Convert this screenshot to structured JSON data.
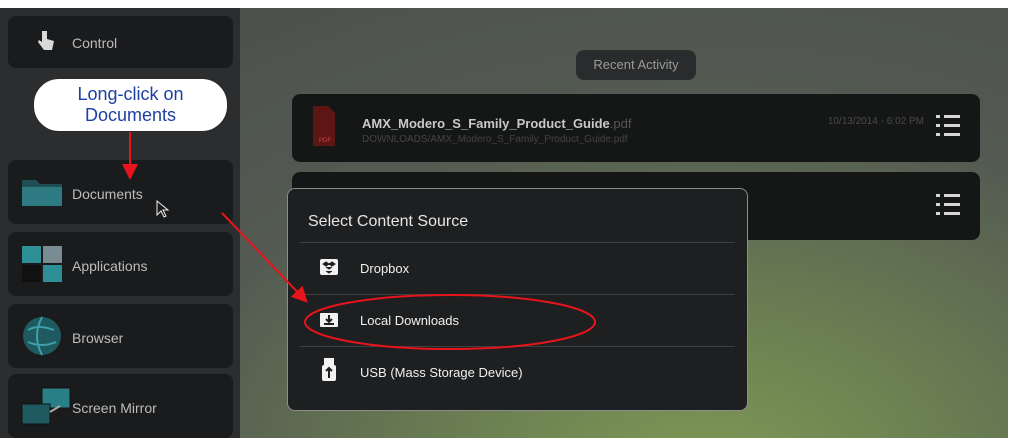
{
  "sidebar": {
    "items": [
      {
        "label": "Control",
        "icon": "hand-pointer-icon"
      },
      {
        "label": "Documents",
        "icon": "folder-icon"
      },
      {
        "label": "Applications",
        "icon": "apps-grid-icon"
      },
      {
        "label": "Browser",
        "icon": "globe-icon"
      },
      {
        "label": "Screen Mirror",
        "icon": "screen-mirror-icon"
      }
    ]
  },
  "recent_activity": {
    "label": "Recent Activity",
    "items": [
      {
        "name": "AMX_Modero_S_Family_Product_Guide",
        "ext": ".pdf",
        "path": "DOWNLOADS/AMX_Modero_S_Family_Product_Guide.pdf",
        "date": "10/13/2014 - 6:02 PM",
        "icon_text": "PDF"
      },
      {
        "name": "",
        "ext": "",
        "path": "",
        "date": ""
      }
    ]
  },
  "dialog": {
    "title": "Select Content Source",
    "options": [
      {
        "label": "Dropbox",
        "icon": "dropbox-icon"
      },
      {
        "label": "Local Downloads",
        "icon": "download-icon"
      },
      {
        "label": "USB (Mass Storage Device)",
        "icon": "usb-icon"
      }
    ]
  },
  "annotation": {
    "callout_text": "Long-click on Documents",
    "arrow_color": "#e8141b"
  }
}
